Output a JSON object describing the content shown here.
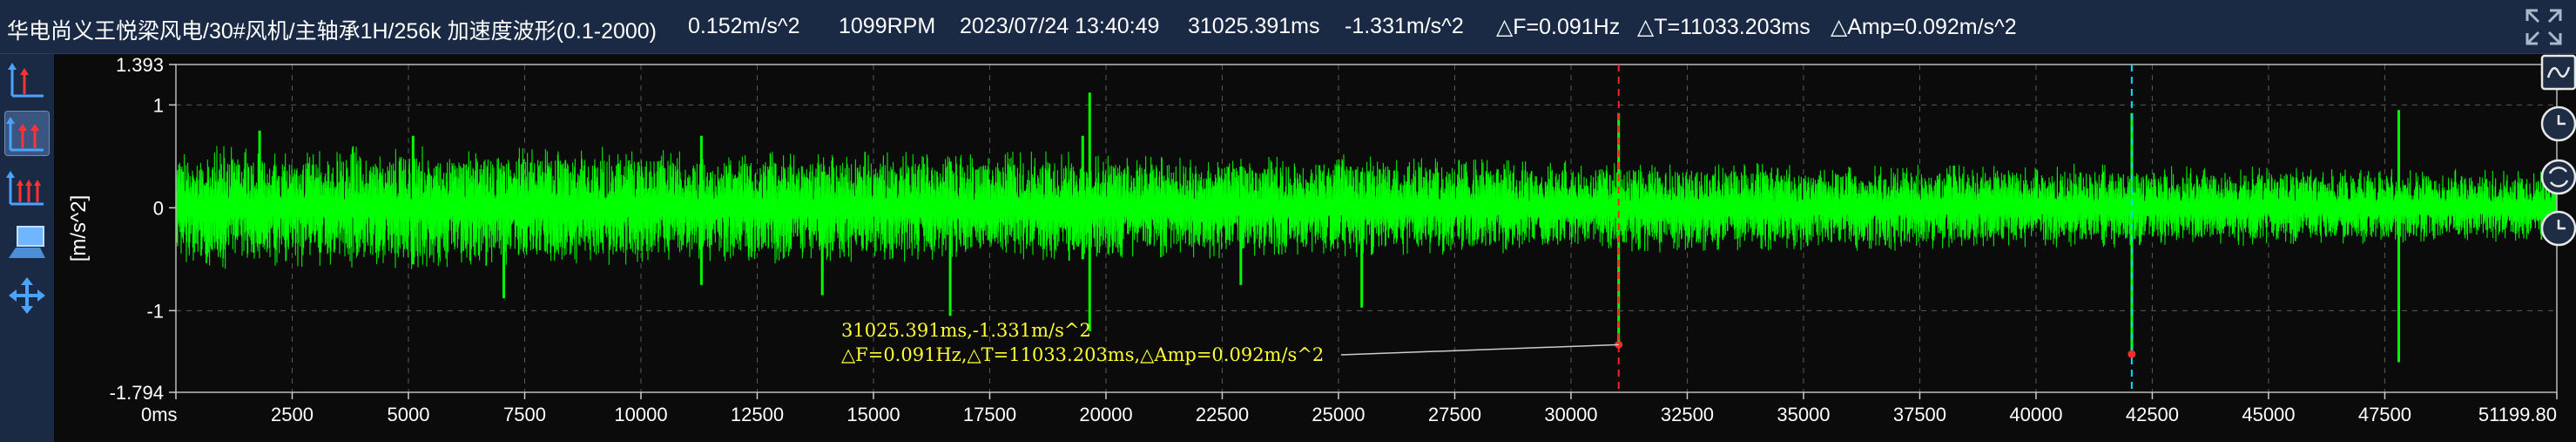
{
  "header": {
    "title": "华电尚义王悦梁风电/30#风机/主轴承1H/256k 加速度波形(0.1-2000)",
    "rms": "0.152m/s^2",
    "speed": "1099RPM",
    "datetime": "2023/07/24 13:40:49",
    "cursor_time": "31025.391ms",
    "cursor_amp": "-1.331m/s^2",
    "delta_f": "△F=0.091Hz",
    "delta_t": "△T=11033.203ms",
    "delta_amp": "△Amp=0.092m/s^2"
  },
  "annotation": {
    "line1": "31025.391ms,-1.331m/s^2",
    "line2": "△F=0.091Hz,△T=11033.203ms,△Amp=0.092m/s^2"
  },
  "colors": {
    "wave": "#00ff00",
    "cursor1": "#ff2222",
    "cursor2": "#00e0ff",
    "annotation": "#ffff33",
    "toolbar_bg": "#1b2a44"
  },
  "toolbar": {
    "left_icons": [
      "single-cursor-icon",
      "double-cursor-icon",
      "multi-cursor-icon",
      "display-icon",
      "move-icon"
    ],
    "right_icons": [
      "waveform-icon",
      "history-icon",
      "refresh-icon",
      "clock-icon"
    ]
  },
  "chart_data": {
    "type": "line",
    "title": "",
    "xlabel": "",
    "ylabel": "[m/s^2]",
    "xlim": [
      0,
      51199.8
    ],
    "ylim": [
      -1.794,
      1.393
    ],
    "x_unit": "ms",
    "x_ticks": [
      0,
      2500,
      5000,
      7500,
      10000,
      12500,
      15000,
      17500,
      20000,
      22500,
      25000,
      27500,
      30000,
      32500,
      35000,
      37500,
      40000,
      42500,
      45000,
      47500,
      51199.8
    ],
    "x_tick_labels": [
      "0ms",
      "2500",
      "5000",
      "7500",
      "10000",
      "12500",
      "15000",
      "17500",
      "20000",
      "22500",
      "25000",
      "27500",
      "30000",
      "32500",
      "35000",
      "37500",
      "40000",
      "42500",
      "45000",
      "47500",
      "51199.80"
    ],
    "y_ticks": [
      1.393,
      1,
      0,
      -1,
      -1.794
    ],
    "y_tick_labels": [
      "1.393",
      "1",
      "0",
      "-1",
      "-1.794"
    ],
    "grid": true,
    "series": [
      {
        "envelope_x": [
          0,
          1000,
          2000,
          3000,
          4000,
          5000,
          6000,
          7000,
          8000,
          9000,
          10000,
          11000,
          12000,
          13000,
          14000,
          15000,
          16000,
          17000,
          18000,
          19000,
          20000,
          21000,
          22000,
          23000,
          24000,
          25000,
          26000,
          27000,
          28000,
          29000,
          30000,
          31000,
          32000,
          33000,
          34000,
          35000,
          36000,
          37000,
          38000,
          39000,
          40000,
          41000,
          42000,
          43000,
          44000,
          45000,
          46000,
          47000,
          48000,
          49000,
          50000,
          51199.8
        ],
        "envelope_upper": [
          0.52,
          0.55,
          0.52,
          0.5,
          0.56,
          0.55,
          0.53,
          0.55,
          0.52,
          0.55,
          0.52,
          0.5,
          0.48,
          0.5,
          0.48,
          0.5,
          0.5,
          0.48,
          0.5,
          0.5,
          0.5,
          0.48,
          0.45,
          0.45,
          0.45,
          0.48,
          0.45,
          0.45,
          0.43,
          0.42,
          0.42,
          0.42,
          0.4,
          0.4,
          0.4,
          0.38,
          0.38,
          0.4,
          0.38,
          0.38,
          0.38,
          0.4,
          0.38,
          0.38,
          0.35,
          0.38,
          0.36,
          0.35,
          0.35,
          0.35,
          0.33,
          0.32
        ],
        "envelope_lower": [
          -0.5,
          -0.55,
          -0.55,
          -0.52,
          -0.55,
          -0.55,
          -0.55,
          -0.52,
          -0.52,
          -0.52,
          -0.5,
          -0.48,
          -0.48,
          -0.5,
          -0.48,
          -0.48,
          -0.48,
          -0.48,
          -0.45,
          -0.48,
          -0.45,
          -0.45,
          -0.45,
          -0.45,
          -0.42,
          -0.45,
          -0.42,
          -0.42,
          -0.42,
          -0.4,
          -0.4,
          -0.38,
          -0.4,
          -0.38,
          -0.38,
          -0.38,
          -0.38,
          -0.38,
          -0.36,
          -0.36,
          -0.35,
          -0.35,
          -0.35,
          -0.33,
          -0.33,
          -0.35,
          -0.32,
          -0.32,
          -0.32,
          -0.3,
          -0.3,
          -0.28
        ]
      }
    ],
    "spikes": [
      {
        "x": 1800,
        "max": 0.75,
        "min": -0.35
      },
      {
        "x": 5100,
        "max": 0.7,
        "min": -0.55
      },
      {
        "x": 7050,
        "max": 0.35,
        "min": -0.88
      },
      {
        "x": 11300,
        "max": 0.7,
        "min": -0.75
      },
      {
        "x": 13900,
        "max": 0.35,
        "min": -0.85
      },
      {
        "x": 16650,
        "max": 0.45,
        "min": -1.05
      },
      {
        "x": 19500,
        "max": 0.7,
        "min": -0.5
      },
      {
        "x": 19650,
        "max": 1.12,
        "min": -1.2
      },
      {
        "x": 22900,
        "max": 0.4,
        "min": -0.75
      },
      {
        "x": 25500,
        "max": 0.35,
        "min": -0.97
      },
      {
        "x": 31025,
        "max": 0.92,
        "min": -1.35
      },
      {
        "x": 42060,
        "max": 0.92,
        "min": -1.43
      },
      {
        "x": 47800,
        "max": 0.95,
        "min": -1.5
      }
    ],
    "cursors": [
      {
        "x": 31025.391,
        "y": -1.331,
        "color": "red"
      },
      {
        "x": 42058.594,
        "y": -1.423,
        "color": "cyan"
      }
    ]
  }
}
